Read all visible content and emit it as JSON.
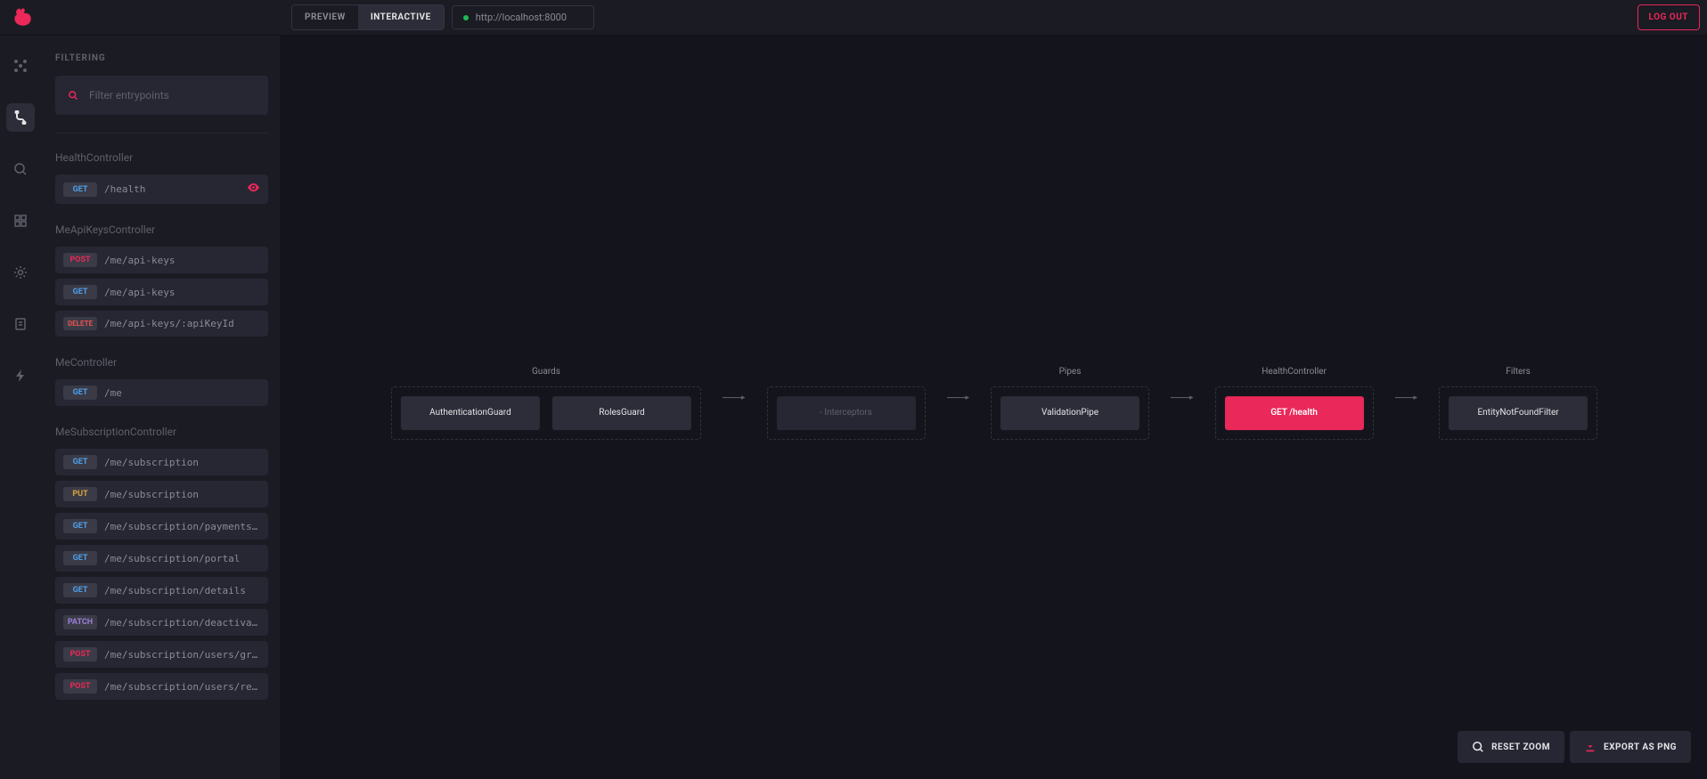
{
  "topbar": {
    "preview_label": "PREVIEW",
    "interactive_label": "INTERACTIVE",
    "url": "http://localhost:8000",
    "logout_label": "LOG OUT"
  },
  "sidebar": {
    "filtering_label": "FILTERING",
    "filter_placeholder": "Filter entrypoints",
    "controllers": [
      {
        "name": "HealthController",
        "endpoints": [
          {
            "method": "GET",
            "path": "/health",
            "active": true
          }
        ]
      },
      {
        "name": "MeApiKeysController",
        "endpoints": [
          {
            "method": "POST",
            "path": "/me/api-keys"
          },
          {
            "method": "GET",
            "path": "/me/api-keys"
          },
          {
            "method": "DELETE",
            "path": "/me/api-keys/:apiKeyId"
          }
        ]
      },
      {
        "name": "MeController",
        "endpoints": [
          {
            "method": "GET",
            "path": "/me"
          }
        ]
      },
      {
        "name": "MeSubscriptionController",
        "endpoints": [
          {
            "method": "GET",
            "path": "/me/subscription"
          },
          {
            "method": "PUT",
            "path": "/me/subscription"
          },
          {
            "method": "GET",
            "path": "/me/subscription/payments-h…"
          },
          {
            "method": "GET",
            "path": "/me/subscription/portal"
          },
          {
            "method": "GET",
            "path": "/me/subscription/details"
          },
          {
            "method": "PATCH",
            "path": "/me/subscription/deactivate"
          },
          {
            "method": "POST",
            "path": "/me/subscription/users/gran…"
          },
          {
            "method": "POST",
            "path": "/me/subscription/users/revo…"
          }
        ]
      }
    ]
  },
  "flow": {
    "columns": [
      {
        "title": "Guards",
        "nodes": [
          "AuthenticationGuard",
          "RolesGuard"
        ],
        "boxed": true
      },
      {
        "title": "",
        "nodes": [
          "- Interceptors"
        ],
        "boxed": true,
        "dim": true
      },
      {
        "title": "Pipes",
        "nodes": [
          "ValidationPipe"
        ],
        "boxed": true
      },
      {
        "title": "HealthController",
        "nodes": [
          "GET /health"
        ],
        "boxed": true,
        "accent": true
      },
      {
        "title": "Filters",
        "nodes": [
          "EntityNotFoundFilter"
        ],
        "boxed": true
      }
    ]
  },
  "buttons": {
    "reset_zoom": "RESET ZOOM",
    "export_png": "EXPORT AS PNG"
  }
}
